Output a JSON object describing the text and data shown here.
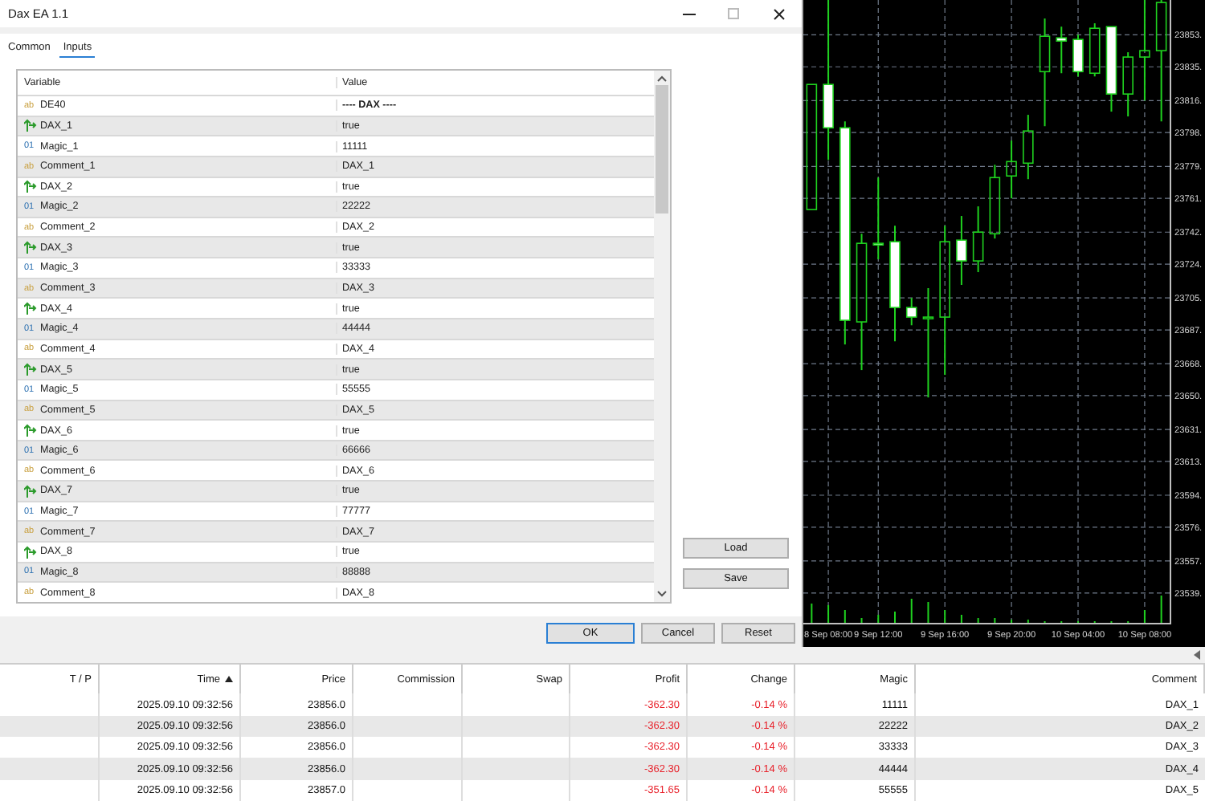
{
  "window": {
    "title": "Dax EA 1.1"
  },
  "tabs": [
    {
      "label": "Common",
      "selected": false
    },
    {
      "label": "Inputs",
      "selected": true
    }
  ],
  "inputs": {
    "columns": [
      "Variable",
      "Value"
    ],
    "rows": [
      {
        "kind": "string",
        "icon": "ab",
        "name": "DE40",
        "value": "---- DAX ----"
      },
      {
        "kind": "bool",
        "name": "DAX_1",
        "value": "true"
      },
      {
        "kind": "int",
        "icon": "01",
        "name": "Magic_1",
        "value": "11111"
      },
      {
        "kind": "string",
        "icon": "ab",
        "name": "Comment_1",
        "value": "DAX_1"
      },
      {
        "kind": "bool",
        "name": "DAX_2",
        "value": "true"
      },
      {
        "kind": "int",
        "icon": "01",
        "name": "Magic_2",
        "value": "22222"
      },
      {
        "kind": "string",
        "icon": "ab",
        "name": "Comment_2",
        "value": "DAX_2"
      },
      {
        "kind": "bool",
        "name": "DAX_3",
        "value": "true"
      },
      {
        "kind": "int",
        "icon": "01",
        "name": "Magic_3",
        "value": "33333"
      },
      {
        "kind": "string",
        "icon": "ab",
        "name": "Comment_3",
        "value": "DAX_3"
      },
      {
        "kind": "bool",
        "name": "DAX_4",
        "value": "true"
      },
      {
        "kind": "int",
        "icon": "01",
        "name": "Magic_4",
        "value": "44444"
      },
      {
        "kind": "string",
        "icon": "ab",
        "name": "Comment_4",
        "value": "DAX_4"
      },
      {
        "kind": "bool",
        "name": "DAX_5",
        "value": "true"
      },
      {
        "kind": "int",
        "icon": "01",
        "name": "Magic_5",
        "value": "55555"
      },
      {
        "kind": "string",
        "icon": "ab",
        "name": "Comment_5",
        "value": "DAX_5"
      },
      {
        "kind": "bool",
        "name": "DAX_6",
        "value": "true"
      },
      {
        "kind": "int",
        "icon": "01",
        "name": "Magic_6",
        "value": "66666"
      },
      {
        "kind": "string",
        "icon": "ab",
        "name": "Comment_6",
        "value": "DAX_6"
      },
      {
        "kind": "bool",
        "name": "DAX_7",
        "value": "true"
      },
      {
        "kind": "int",
        "icon": "01",
        "name": "Magic_7",
        "value": "77777"
      },
      {
        "kind": "string",
        "icon": "ab",
        "name": "Comment_7",
        "value": "DAX_7"
      },
      {
        "kind": "bool",
        "name": "DAX_8",
        "value": "true"
      },
      {
        "kind": "int",
        "icon": "01",
        "name": "Magic_8",
        "value": "88888"
      },
      {
        "kind": "string",
        "icon": "ab",
        "name": "Comment_8",
        "value": "DAX_8"
      }
    ]
  },
  "side_buttons": [
    "Load",
    "Save"
  ],
  "dialog_buttons": [
    {
      "label": "OK",
      "default": true
    },
    {
      "label": "Cancel",
      "default": false
    },
    {
      "label": "Reset",
      "default": false
    }
  ],
  "chart": {
    "chart_data": {
      "type": "candlestick",
      "categories": [
        null,
        "8 Sep 08:00",
        null,
        null,
        "9 Sep 12:00",
        null,
        null,
        null,
        "9 Sep 16:00",
        null,
        null,
        null,
        "9 Sep 20:00",
        null,
        null,
        null,
        "10 Sep 04:00",
        null,
        null,
        null,
        "10 Sep 08:00",
        null
      ],
      "ylim": [
        23522.2,
        23872.6
      ],
      "grid": true,
      "ohlc": [
        [
          23754.7,
          23825.1,
          23754.7,
          23825.1
        ],
        [
          23825.1,
          23873.0,
          23782.6,
          23800.7
        ],
        [
          23800.7,
          23804.3,
          23678.8,
          23692.4
        ],
        [
          23691.5,
          23741.1,
          23664.4,
          23735.7
        ],
        [
          23735.7,
          23772.7,
          23726.7,
          23734.8
        ],
        [
          23736.6,
          23745.6,
          23680.6,
          23699.6
        ],
        [
          23699.6,
          23705.0,
          23689.6,
          23694.2
        ],
        [
          23693.3,
          23710.5,
          23649.0,
          23694.2
        ],
        [
          23694.2,
          23745.6,
          23661.7,
          23736.6
        ],
        [
          23737.5,
          23751.1,
          23712.3,
          23725.8
        ],
        [
          23725.8,
          23756.5,
          23719.5,
          23742.0
        ],
        [
          23741.1,
          23779.9,
          23738.4,
          23772.7
        ],
        [
          23773.6,
          23793.5,
          23761.0,
          23781.7
        ],
        [
          23780.8,
          23808.0,
          23771.8,
          23798.9
        ],
        [
          23832.3,
          23862.2,
          23801.6,
          23852.2
        ],
        [
          23851.3,
          23857.6,
          23831.4,
          23849.5
        ],
        [
          23850.4,
          23853.1,
          23829.6,
          23832.3
        ],
        [
          23831.4,
          23859.5,
          23829.6,
          23856.7
        ],
        [
          23857.6,
          23857.6,
          23809.8,
          23819.7
        ],
        [
          23819.7,
          23843.2,
          23807.1,
          23840.5
        ],
        [
          23840.5,
          23873.0,
          23816.1,
          23844.1
        ],
        [
          23844.1,
          23873.0,
          23804.3,
          23871.2
        ]
      ],
      "yticks": [
        {
          "value": 23853,
          "label": "23853."
        },
        {
          "value": 23835,
          "label": "23835."
        },
        {
          "value": 23816,
          "label": "23816."
        },
        {
          "value": 23798,
          "label": "23798."
        },
        {
          "value": 23779,
          "label": "23779."
        },
        {
          "value": 23761,
          "label": "23761."
        },
        {
          "value": 23742,
          "label": "23742."
        },
        {
          "value": 23724,
          "label": "23724."
        },
        {
          "value": 23705,
          "label": "23705."
        },
        {
          "value": 23687,
          "label": "23687."
        },
        {
          "value": 23668,
          "label": "23668."
        },
        {
          "value": 23650,
          "label": "23650."
        },
        {
          "value": 23631,
          "label": "23631."
        },
        {
          "value": 23613,
          "label": "23613."
        },
        {
          "value": 23594,
          "label": "23594."
        },
        {
          "value": 23576,
          "label": "23576."
        },
        {
          "value": 23557,
          "label": "23557."
        },
        {
          "value": 23539,
          "label": "23539."
        }
      ]
    }
  },
  "trades": {
    "columns": [
      {
        "label": "T / P",
        "sorted": false
      },
      {
        "label": "Time",
        "sorted": true
      },
      {
        "label": "Price",
        "sorted": false
      },
      {
        "label": "Commission",
        "sorted": false
      },
      {
        "label": "Swap",
        "sorted": false
      },
      {
        "label": "Profit",
        "sorted": false
      },
      {
        "label": "Change",
        "sorted": false
      },
      {
        "label": "Magic",
        "sorted": false
      },
      {
        "label": "Comment",
        "sorted": false
      }
    ],
    "rows": [
      {
        "time": "2025.09.10 09:32:56",
        "price": "23856.0",
        "profit": "-362.30",
        "change": "-0.14 %",
        "magic": "11111",
        "comment": "DAX_1"
      },
      {
        "time": "2025.09.10 09:32:56",
        "price": "23856.0",
        "profit": "-362.30",
        "change": "-0.14 %",
        "magic": "22222",
        "comment": "DAX_2"
      },
      {
        "time": "2025.09.10 09:32:56",
        "price": "23856.0",
        "profit": "-362.30",
        "change": "-0.14 %",
        "magic": "33333",
        "comment": "DAX_3"
      },
      {
        "time": "2025.09.10 09:32:56",
        "price": "23856.0",
        "profit": "-362.30",
        "change": "-0.14 %",
        "magic": "44444",
        "comment": "DAX_4"
      },
      {
        "time": "2025.09.10 09:32:56",
        "price": "23857.0",
        "profit": "-351.65",
        "change": "-0.14 %",
        "magic": "55555",
        "comment": "DAX_5"
      }
    ]
  }
}
